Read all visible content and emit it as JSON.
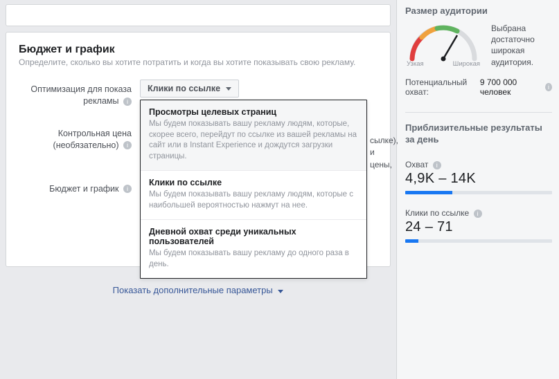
{
  "section": {
    "title": "Бюджет и график",
    "subtitle": "Определите, сколько вы хотите потратить и когда вы хотите показывать свою рекламу."
  },
  "rows": {
    "optimization": {
      "label": "Оптимизация для показа рекламы",
      "selected": "Клики по ссылке"
    },
    "price": {
      "label_l1": "Контрольная цена",
      "label_l2": "(необязательно)"
    },
    "budget": {
      "label": "Бюджет и график"
    }
  },
  "dropdown": [
    {
      "title": "Просмотры целевых страниц",
      "desc": "Мы будем показывать вашу рекламу людям, которые, скорее всего, перейдут по ссылке из вашей рекламы на сайт или в Instant Experience и дождутся загрузки страницы."
    },
    {
      "title": "Клики по ссылке",
      "desc": "Мы будем показывать вашу рекламу людям, которые с наибольшей вероятностью нажмут на нее."
    },
    {
      "title": "Дневной охват среди уникальных пользователей",
      "desc": "Мы будем показывать вашу рекламу до одного раза в день."
    }
  ],
  "peek": {
    "line1": "сылке),",
    "line2": "и цены,"
  },
  "show_more": "Показать дополнительные параметры",
  "sidebar": {
    "audience_size": {
      "heading": "Размер аудитории",
      "gauge": {
        "left": "Узкая",
        "right": "Широкая"
      },
      "message": "Выбрана достаточно широкая аудитория.",
      "potential_label": "Потенциальный охват:",
      "potential_value": "9 700 000 человек"
    },
    "estimates": {
      "heading": "Приблизительные результаты за день",
      "reach": {
        "label": "Охват",
        "value": "4,9K – 14K",
        "bar_pct": 32
      },
      "clicks": {
        "label": "Клики по ссылке",
        "value": "24 – 71",
        "bar_pct": 9
      }
    }
  }
}
